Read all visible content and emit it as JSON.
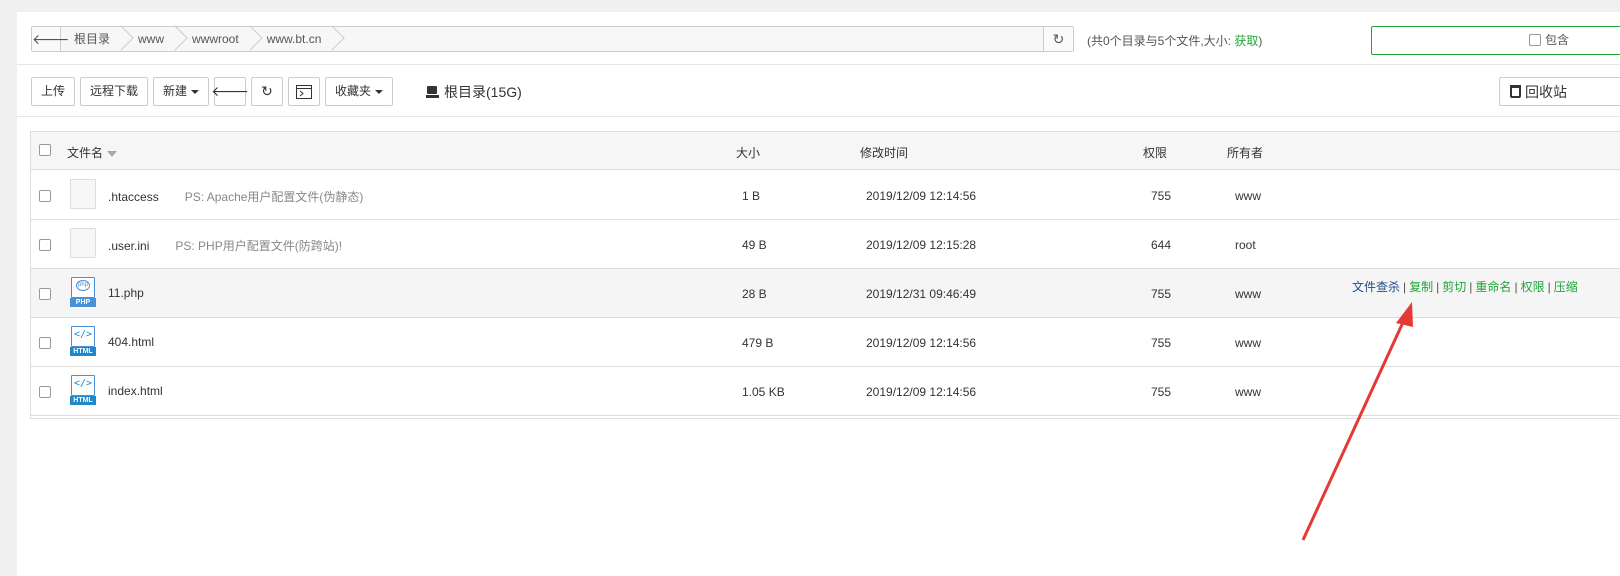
{
  "path": {
    "back_icon": "arrow-left-icon",
    "crumbs": [
      "根目录",
      "www",
      "wwwroot",
      "www.bt.cn"
    ],
    "refresh_icon": "refresh-icon"
  },
  "summary": {
    "text": "(共0个目录与5个文件,大小: ",
    "fetch_label": "获取",
    "close": ")"
  },
  "search": {
    "value": "",
    "include_label": "包含"
  },
  "toolbar": {
    "upload": "上传",
    "remote_download": "远程下载",
    "new": "新建",
    "favorites": "收藏夹",
    "disk_label": "根目录(15G)",
    "recycle": "回收站"
  },
  "columns": {
    "name": "文件名",
    "size": "大小",
    "mtime": "修改时间",
    "perm": "权限",
    "owner": "所有者"
  },
  "files": [
    {
      "name": ".htaccess",
      "note": "PS: Apache用户配置文件(伪静态)",
      "size": "1 B",
      "mtime": "2019/12/09 12:14:56",
      "perm": "755",
      "owner": "www",
      "type": "blank"
    },
    {
      "name": ".user.ini",
      "note": "PS: PHP用户配置文件(防跨站)!",
      "size": "49 B",
      "mtime": "2019/12/09 12:15:28",
      "perm": "644",
      "owner": "root",
      "type": "blank"
    },
    {
      "name": "11.php",
      "note": "",
      "size": "28 B",
      "mtime": "2019/12/31 09:46:49",
      "perm": "755",
      "owner": "www",
      "type": "php"
    },
    {
      "name": "404.html",
      "note": "",
      "size": "479 B",
      "mtime": "2019/12/09 12:14:56",
      "perm": "755",
      "owner": "www",
      "type": "html"
    },
    {
      "name": "index.html",
      "note": "",
      "size": "1.05 KB",
      "mtime": "2019/12/09 12:14:56",
      "perm": "755",
      "owner": "www",
      "type": "html"
    }
  ],
  "row_ops": {
    "scan": "文件查杀",
    "copy": "复制",
    "cut": "剪切",
    "rename": "重命名",
    "perm": "权限",
    "compress": "压缩"
  },
  "file_tags": {
    "php": "PHP",
    "html": "HTML",
    "php_glyph": "php",
    "html_glyph": "</>"
  },
  "colors": {
    "accent": "#20a53a",
    "scan_link": "#1d4d8f",
    "arrow": "#e53935"
  }
}
